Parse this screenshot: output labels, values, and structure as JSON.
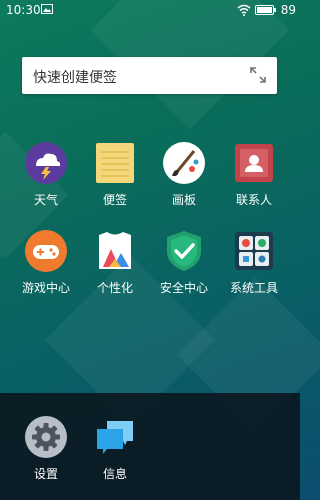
{
  "status_bar": {
    "time": "10:30",
    "battery": "89"
  },
  "widget": {
    "placeholder": "快速创建便签"
  },
  "apps": [
    {
      "label": "天气",
      "icon": "weather-icon"
    },
    {
      "label": "便签",
      "icon": "notes-icon"
    },
    {
      "label": "画板",
      "icon": "paint-board-icon"
    },
    {
      "label": "联系人",
      "icon": "contacts-icon"
    },
    {
      "label": "游戏中心",
      "icon": "game-center-icon"
    },
    {
      "label": "个性化",
      "icon": "personalization-icon"
    },
    {
      "label": "安全中心",
      "icon": "security-icon"
    },
    {
      "label": "系统工具",
      "icon": "system-tools-icon"
    }
  ],
  "dock": [
    {
      "label": "设置",
      "icon": "settings-icon"
    },
    {
      "label": "信息",
      "icon": "messages-icon"
    }
  ],
  "colors": {
    "weather": "#5b3c9e",
    "notes": "#f4d77a",
    "contacts": "#c2434a",
    "game": "#f07a2e",
    "security": "#1fa06c",
    "settings": "#b8bec6",
    "messages": "#2aa3e8"
  }
}
